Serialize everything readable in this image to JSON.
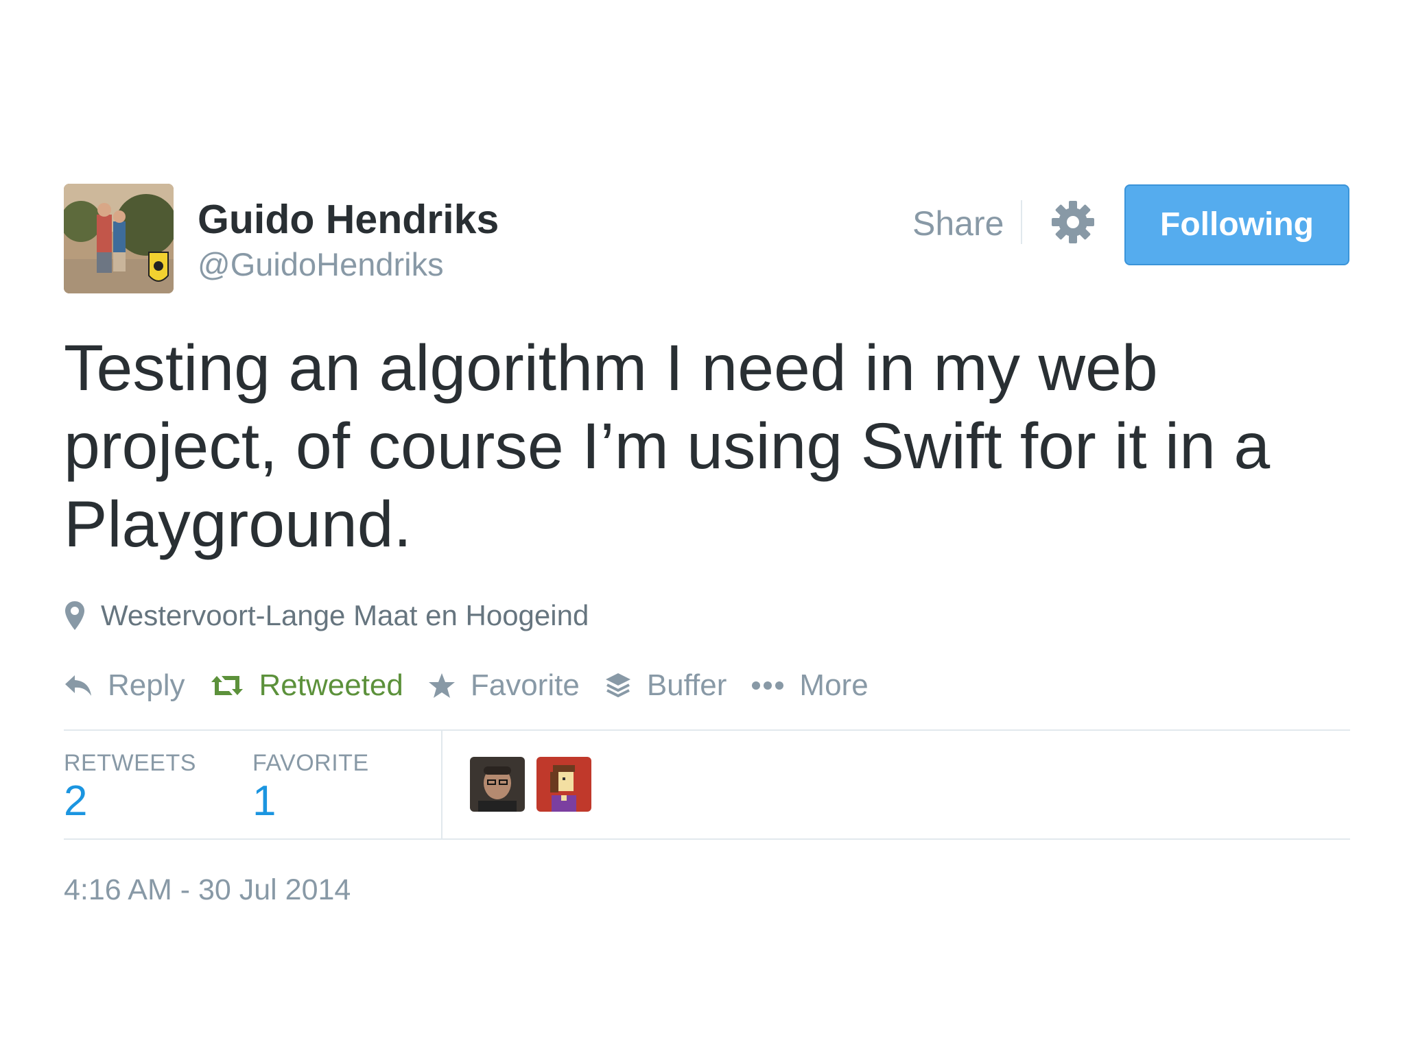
{
  "tweet": {
    "display_name": "Guido Hendriks",
    "screen_name": "@GuidoHendriks",
    "text": "Testing an algorithm I need in my web project, of course I’m using Swift for it in a Playground.",
    "location": "Westervoort-Lange Maat en Hoogeind",
    "timestamp": "4:16 AM - 30 Jul 2014"
  },
  "header": {
    "share_label": "Share",
    "follow_label": "Following"
  },
  "actions": {
    "reply": "Reply",
    "retweeted": "Retweeted",
    "favorite": "Favorite",
    "buffer": "Buffer",
    "more": "More"
  },
  "stats": {
    "retweets_label": "RETWEETS",
    "retweets_value": "2",
    "favorite_label": "FAVORITE",
    "favorite_value": "1"
  },
  "icons": {
    "location": "map-pin-icon",
    "reply": "reply-arrow-icon",
    "retweet": "retweet-icon",
    "favorite": "star-icon",
    "buffer": "stack-layers-icon",
    "more": "ellipsis-icon",
    "settings": "gear-icon"
  },
  "colors": {
    "follow_button": "#55acee",
    "retweeted": "#5c913b",
    "stat_value": "#1b95e0",
    "muted_text": "#8899a6"
  }
}
